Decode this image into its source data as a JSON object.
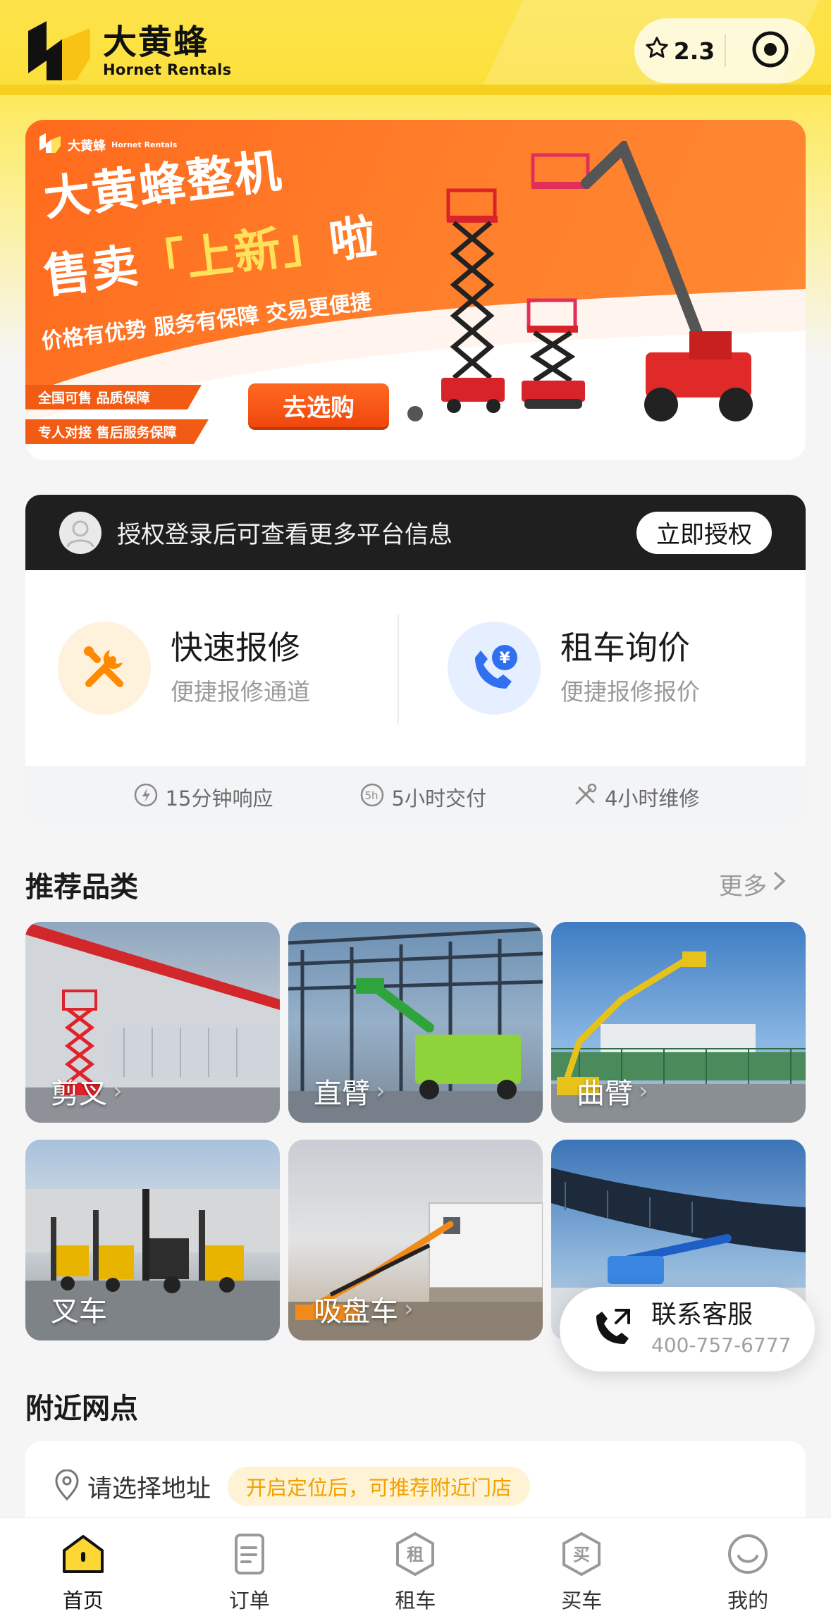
{
  "header": {
    "logo_cn": "大黄蜂",
    "logo_en": "Hornet Rentals",
    "rating": "2.3"
  },
  "banner": {
    "brand": "大黄蜂",
    "brand_en": "Hornet Rentals",
    "headline_line1": "大黄蜂整机",
    "headline_line2_prefix": "售卖",
    "headline_line2_highlight": "「上新」",
    "headline_line2_suffix": "啦",
    "subline": "价格有优势 服务有保障 交易更便捷",
    "tags": [
      "全国可售  品质保障",
      "专人对接  售后服务保障"
    ],
    "cta": "去选购"
  },
  "login_bar": {
    "message": "授权登录后可查看更多平台信息",
    "button": "立即授权"
  },
  "quick_actions": [
    {
      "title": "快速报修",
      "subtitle": "便捷报修通道",
      "icon": "wrench-icon"
    },
    {
      "title": "租车询价",
      "subtitle": "便捷报修报价",
      "icon": "phone-yuan-icon"
    }
  ],
  "features": [
    "15分钟响应",
    "5小时交付",
    "4小时维修"
  ],
  "recommended": {
    "title": "推荐品类",
    "more": "更多",
    "categories": [
      {
        "label": "剪叉"
      },
      {
        "label": "直臂"
      },
      {
        "label": "曲臂"
      },
      {
        "label": "叉车"
      },
      {
        "label": "吸盘车"
      },
      {
        "label": ""
      }
    ]
  },
  "contact": {
    "label": "联系客服",
    "phone": "400-757-6777"
  },
  "nearby": {
    "title": "附近网点",
    "address_placeholder": "请选择地址",
    "hint": "开启定位后，可推荐附近门店"
  },
  "tabbar": [
    {
      "label": "首页",
      "icon": "home-icon",
      "active": true
    },
    {
      "label": "订单",
      "icon": "order-icon",
      "active": false
    },
    {
      "label": "租车",
      "icon": "rent-icon",
      "active": false
    },
    {
      "label": "买车",
      "icon": "buy-icon",
      "active": false
    },
    {
      "label": "我的",
      "icon": "profile-icon",
      "active": false
    }
  ],
  "colors": {
    "brand_yellow": "#fce142",
    "banner_orange": "#ff7424",
    "dark_bar": "#1f1f1f",
    "hint_orange": "#f2a100"
  }
}
